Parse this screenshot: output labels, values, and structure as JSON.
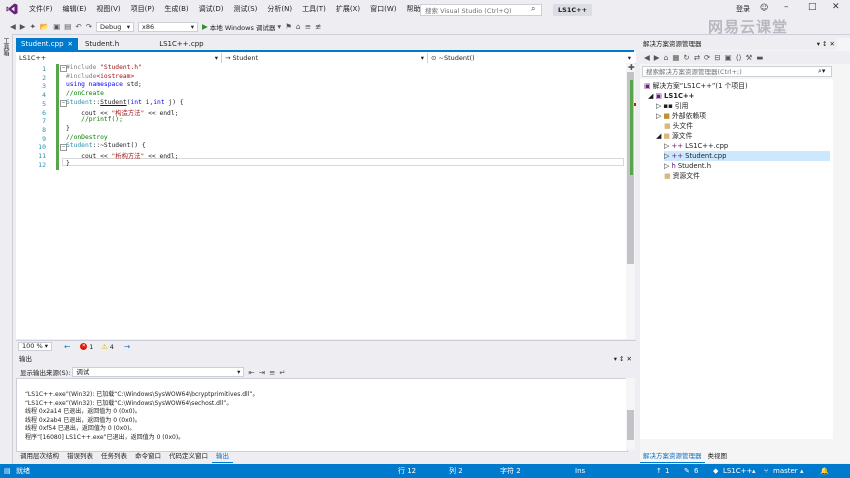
{
  "titlebar": {
    "menu": [
      "文件(F)",
      "编辑(E)",
      "视图(V)",
      "项目(P)",
      "生成(B)",
      "调试(D)",
      "测试(S)",
      "分析(N)",
      "工具(T)",
      "扩展(X)",
      "窗口(W)",
      "帮助(H)"
    ],
    "search_placeholder": "搜索 Visual Studio (Ctrl+Q)",
    "solution_name": "LS1C++",
    "login_label": "登录",
    "watermark": "网易云课堂"
  },
  "toolbar": {
    "config": "Debug",
    "platform": "x86",
    "run_label": "本地 Windows 调试器"
  },
  "left_strip": [
    "工具箱"
  ],
  "doc_tabs": [
    {
      "label": "Student.cpp",
      "active": true
    },
    {
      "label": "Student.h",
      "active": false
    },
    {
      "label": "LS1C++.cpp",
      "active": false
    }
  ],
  "navbar": {
    "project": "LS1C++",
    "scope": "Student",
    "member": "~Student()"
  },
  "code": {
    "line_numbers": [
      "1",
      "2",
      "3",
      "4",
      "5",
      "6",
      "7",
      "8",
      "9",
      "10",
      "11",
      "12"
    ]
  },
  "editor_status": {
    "zoom": "100 %",
    "errors": "1",
    "warnings": "4"
  },
  "output": {
    "title": "输出",
    "source_label": "显示输出来源(S):",
    "source_value": "调试",
    "lines": [
      "“LS1C++.exe”(Win32): 已加载“C:\\Windows\\SysWOW64\\bcryptprimitives.dll”。",
      "“LS1C++.exe”(Win32): 已加载“C:\\Windows\\SysWOW64\\sechost.dll”。",
      "线程 0x2a14 已退出，返回值为 0 (0x0)。",
      "线程 0x2ab4 已退出，返回值为 0 (0x0)。",
      "线程 0xf54 已退出，返回值为 0 (0x0)。",
      "程序“[16080] LS1C++.exe”已退出，返回值为 0 (0x0)。"
    ]
  },
  "bottom_tabs": [
    "调用层次结构",
    "错误列表",
    "任务列表",
    "命令窗口",
    "代码定义窗口",
    "输出"
  ],
  "solution_explorer": {
    "title": "解决方案资源管理器",
    "search_placeholder": "搜索解决方案资源管理器(Ctrl+;)",
    "solution_label": "解决方案“LS1C++”(1 个项目)",
    "project": "LS1C++",
    "references": "引用",
    "external_deps": "外部依赖项",
    "header_files": "头文件",
    "source_files": "源文件",
    "file_main": "LS1C++.cpp",
    "file_student_cpp": "Student.cpp",
    "file_student_h": "Student.h",
    "resource_files": "资源文件",
    "bottom_tabs": [
      "解决方案资源管理器",
      "类视图"
    ]
  },
  "statusbar": {
    "ready": "就绪",
    "row": "行 12",
    "col": "列 2",
    "char": "字符 2",
    "mode": "Ins",
    "up_count": "1",
    "edit_count": "6",
    "repo": "LS1C++",
    "branch": "master"
  }
}
